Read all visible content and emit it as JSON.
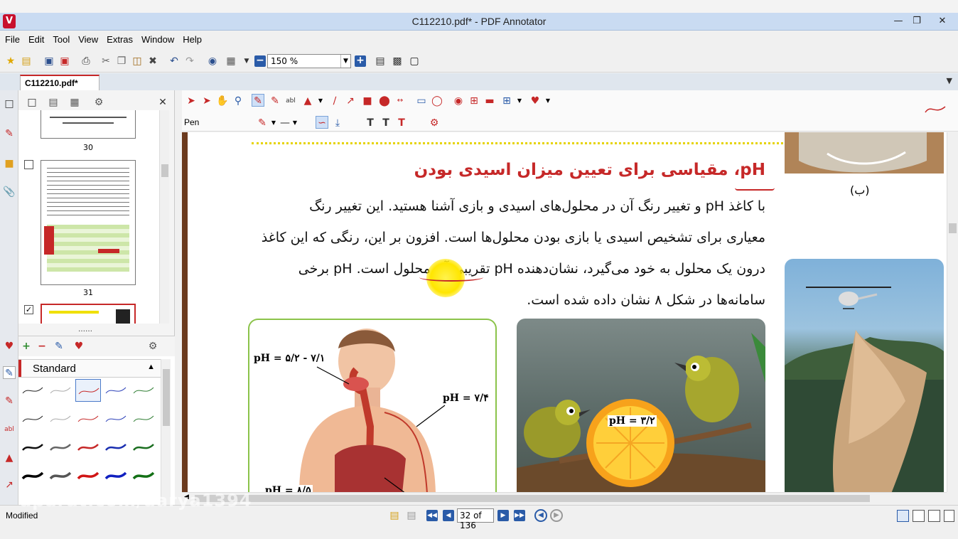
{
  "window": {
    "title": "C112210.pdf* - PDF Annotator",
    "app_icon_label": "V"
  },
  "menu": [
    "File",
    "Edit",
    "Tool",
    "View",
    "Extras",
    "Window",
    "Help"
  ],
  "toolbar": {
    "zoom_value": "150 %"
  },
  "tabs": {
    "active_document": "C112210.pdf*"
  },
  "thumbnails": {
    "pages": [
      {
        "label": "30"
      },
      {
        "label": "31"
      }
    ]
  },
  "pen_panel": {
    "style_set": "Standard"
  },
  "annotation_toolbar": {
    "current_tool_label": "Pen"
  },
  "document": {
    "heading": "pH، مقیاسی برای تعیین میزان اسیدی بودن",
    "paragraph_lines": [
      "با کاغذ pH و تغییر رنگ آن در محلول‌های اسیدی و بازی آشنا هستید. این تغییر رنگ",
      "معیاری برای تشخیص اسیدی یا بازی بودن محلول‌ها است. افزون بر این، رنگی که این کاغذ",
      "درون یک محلول به خود می‌گیرد، نشان‌دهنده pH تقریبی آن محلول است. pH برخی",
      "سامانه‌ها در شکل ۸ نشان داده شده است."
    ],
    "caption_b": "(ب)",
    "ph_labels": {
      "mouth": "pH = ۵/۲ - ۷/۱",
      "arm": "pH = ۷/۴",
      "stomach": "pH = ۸/۵",
      "orange": "pH = ۳/۲"
    }
  },
  "status": {
    "state": "Modified",
    "page_indicator": "32 of 136"
  },
  "watermark": "aparat.com/darya1394"
}
